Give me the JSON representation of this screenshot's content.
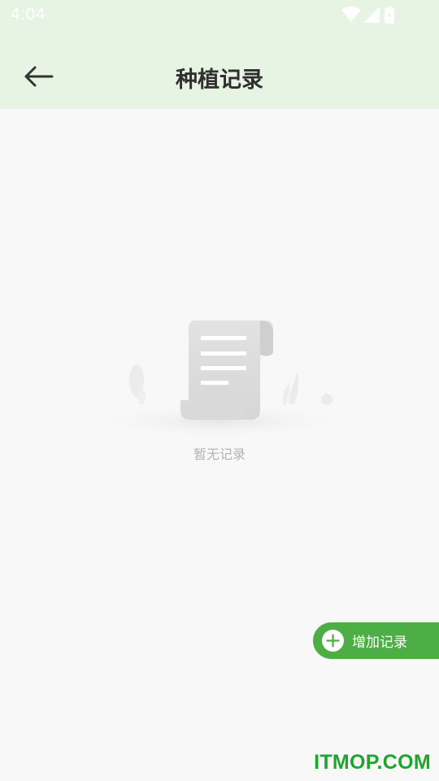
{
  "status_bar": {
    "time": "4:04",
    "icons": [
      "wifi-icon",
      "signal-icon",
      "battery-icon"
    ]
  },
  "header": {
    "title": "种植记录",
    "back_icon": "arrow-left-icon"
  },
  "empty_state": {
    "icon": "document-scroll-icon",
    "text": "暂无记录"
  },
  "fab": {
    "label": "增加记录",
    "icon": "plus-circle-icon",
    "color": "#4cae44"
  },
  "watermark": {
    "text": "ITMOP.COM"
  },
  "colors": {
    "header_bg": "#e7f3e3",
    "page_bg": "#f8f8f8",
    "accent": "#4cae44"
  }
}
